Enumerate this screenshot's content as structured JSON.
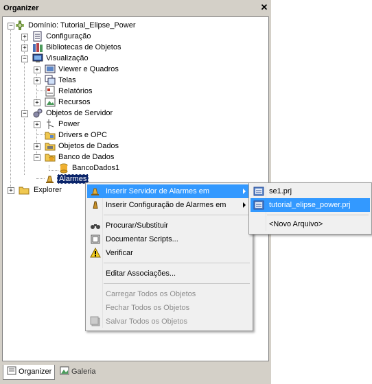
{
  "panel": {
    "title": "Organizer"
  },
  "tree": {
    "root": "Domínio: Tutorial_Elipse_Power",
    "configuracao": "Configuração",
    "bibliotecas": "Bibliotecas de Objetos",
    "visualizacao": "Visualização",
    "viewer": "Viewer e Quadros",
    "telas": "Telas",
    "relatorios": "Relatórios",
    "recursos": "Recursos",
    "objetos_servidor": "Objetos de Servidor",
    "power": "Power",
    "drivers": "Drivers e OPC",
    "objetos_dados": "Objetos de Dados",
    "banco": "Banco de Dados",
    "bancodados1": "BancoDados1",
    "alarmes": "Alarmes",
    "explorer": "Explorer"
  },
  "context_menu": {
    "inserir_servidor": "Inserir Servidor de Alarmes em",
    "inserir_config": "Inserir Configuração de Alarmes em",
    "procurar": "Procurar/Substituir",
    "documentar": "Documentar Scripts...",
    "verificar": "Verificar",
    "editar": "Editar Associações...",
    "carregar": "Carregar Todos os Objetos",
    "fechar": "Fechar Todos os Objetos",
    "salvar": "Salvar Todos os Objetos"
  },
  "submenu": {
    "items": [
      "se1.prj",
      "tutorial_elipse_power.prj"
    ],
    "novo": "<Novo Arquivo>"
  },
  "tabs": {
    "organizer": "Organizer",
    "galeria": "Galeria"
  },
  "colors": {
    "selection": "#0a246a",
    "menu_highlight": "#3399ff"
  }
}
